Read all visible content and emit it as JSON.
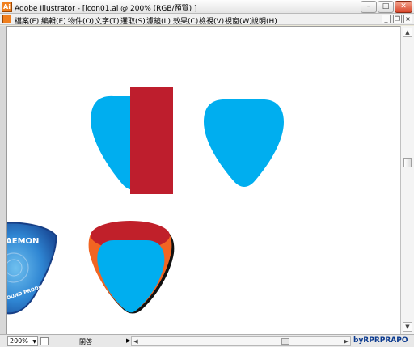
{
  "window": {
    "app_icon_label": "Ai",
    "title": "Adobe Illustrator - [icon01.ai @ 200% (RGB/預覽) ]",
    "min_glyph": "–",
    "max_glyph": "□",
    "close_glyph": "✕"
  },
  "menu": {
    "items": [
      "檔案(F)",
      "編輯(E)",
      "物件(O)",
      "文字(T)",
      "選取(S)",
      "濾鏡(L)",
      "效果(C)",
      "檢視(V)",
      "視窗(W)",
      "說明(H)"
    ],
    "doc_min_glyph": "_",
    "doc_restore_glyph": "❐",
    "doc_close_glyph": "×"
  },
  "colors": {
    "pick_blue": "#00aeef",
    "rect_red": "#be1e2d",
    "dark_red": "#c0202a",
    "orange": "#f26522",
    "badge_blue": "#1f5fb0",
    "badge_light": "#4aa3e0"
  },
  "badge": {
    "top_text": "AEMON",
    "bottom_text": "OUND PRODUCTS"
  },
  "statusbar": {
    "zoom": "200%",
    "zoom_arrow": "▼",
    "status_text": "開啓",
    "status_arrow": "▶",
    "left_arrow": "◀",
    "right_arrow": "▶",
    "watermark": "byRPRPRAPO"
  },
  "vscroll": {
    "up_arrow": "▲",
    "down_arrow": "▼"
  }
}
